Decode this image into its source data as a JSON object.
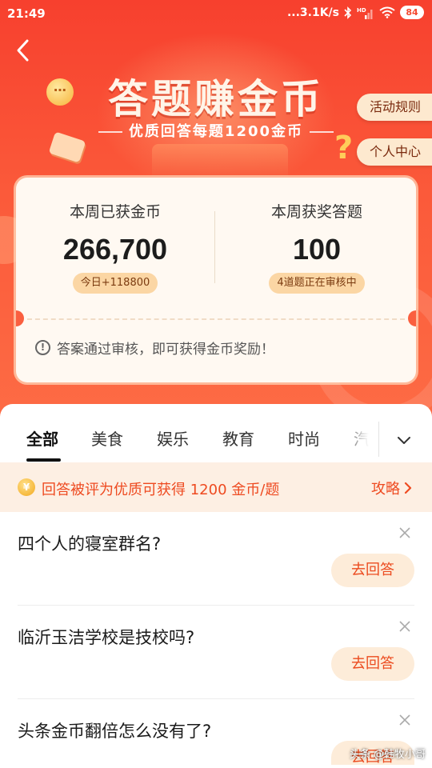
{
  "status_bar": {
    "time": "21:49",
    "network_speed": "...3.1K/s",
    "battery": "84",
    "icons": [
      "bluetooth-icon",
      "hd-signal-icon",
      "wifi-icon",
      "battery-icon"
    ]
  },
  "header": {
    "title": "答题赚金币",
    "subtitle": "优质回答每题1200金币",
    "rules_label": "活动规则",
    "center_label": "个人中心"
  },
  "stats": {
    "left": {
      "label": "本周已获金币",
      "value": "266,700",
      "badge": "今日+118800"
    },
    "right": {
      "label": "本周获奖答题",
      "value": "100",
      "badge": "4道题正在审核中"
    },
    "notice": "答案通过审核，即可获得金币奖励！"
  },
  "tabs": {
    "items": [
      "全部",
      "美食",
      "娱乐",
      "教育",
      "时尚",
      "汽"
    ],
    "active_index": 0
  },
  "promo": {
    "text": "回答被评为优质可获得 1200 金币/题",
    "link_label": "攻略"
  },
  "questions": [
    {
      "title": "四个人的寝室群名?",
      "button_label": "去回答"
    },
    {
      "title": "临沂玉洁学校是技校吗?",
      "button_label": "去回答"
    },
    {
      "title": "头条金币翻倍怎么没有了?",
      "button_label": "去回答"
    }
  ],
  "watermark": "头条 @韩牧小哥",
  "colors": {
    "header_red": "#f7402e",
    "accent_orange": "#ee4a20",
    "button_bg": "#fdecd9",
    "promo_bg": "#fdefe3"
  }
}
